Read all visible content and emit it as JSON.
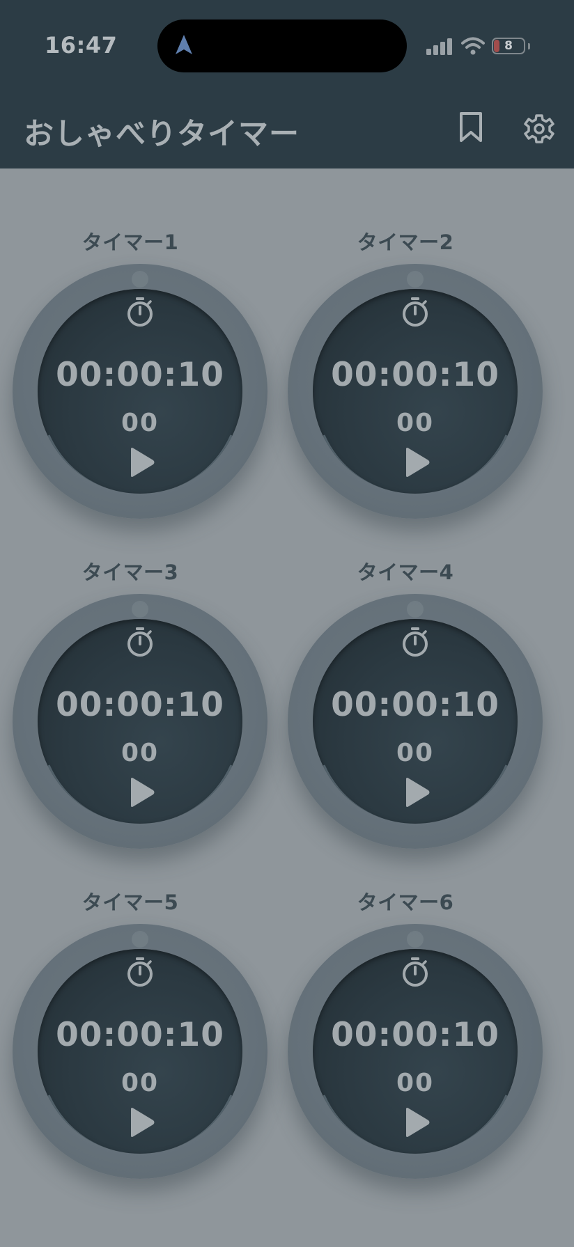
{
  "status_bar": {
    "time": "16:47",
    "battery_level": "8",
    "battery_fraction": 0.08
  },
  "header": {
    "title": "おしゃべりタイマー",
    "bookmark_icon": "bookmark-icon",
    "settings_icon": "gear-icon"
  },
  "colors": {
    "header_bg": "#2c3c45",
    "body_bg": "#8f969b",
    "dial_outer": "#65717a",
    "dial_inner": "#2b3941",
    "text_light": "#a3aaae",
    "battery_low": "#a24d4c"
  },
  "timers": [
    {
      "label": "タイマー1",
      "time": "00:00:10",
      "sub": "00",
      "icon": "stopwatch-icon",
      "action_icon": "play-icon"
    },
    {
      "label": "タイマー2",
      "time": "00:00:10",
      "sub": "00",
      "icon": "stopwatch-icon",
      "action_icon": "play-icon"
    },
    {
      "label": "タイマー3",
      "time": "00:00:10",
      "sub": "00",
      "icon": "stopwatch-icon",
      "action_icon": "play-icon"
    },
    {
      "label": "タイマー4",
      "time": "00:00:10",
      "sub": "00",
      "icon": "stopwatch-icon",
      "action_icon": "play-icon"
    },
    {
      "label": "タイマー5",
      "time": "00:00:10",
      "sub": "00",
      "icon": "stopwatch-icon",
      "action_icon": "play-icon"
    },
    {
      "label": "タイマー6",
      "time": "00:00:10",
      "sub": "00",
      "icon": "stopwatch-icon",
      "action_icon": "play-icon"
    }
  ]
}
